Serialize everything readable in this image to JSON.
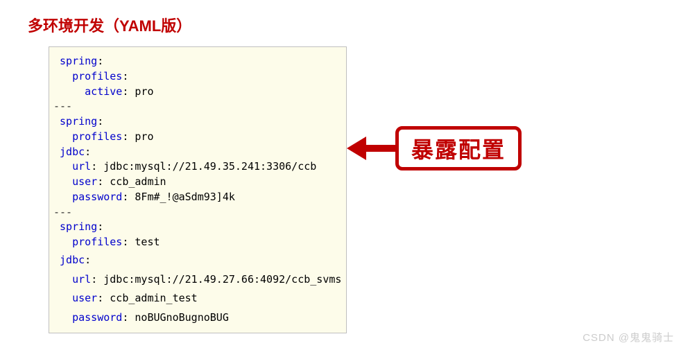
{
  "title": "多环境开发（YAML版）",
  "callout": "暴露配置",
  "watermark": "CSDN @鬼鬼骑士",
  "yaml": {
    "l1_key": "spring",
    "l2_key": "profiles",
    "l3_key": "active",
    "l3_val": "pro",
    "sep": "---",
    "l4_key": "spring",
    "l5_key": "profiles",
    "l5_val": "pro",
    "l6_key": "jdbc",
    "l7_key": "url",
    "l7_val": "jdbc:mysql://21.49.35.241:3306/ccb",
    "l8_key": "user",
    "l8_val": "ccb_admin",
    "l9_key": "password",
    "l9_val": "8Fm#_!@aSdm93]4k",
    "l10_key": "spring",
    "l11_key": "profiles",
    "l11_val": "test",
    "l12_key": "jdbc",
    "l13_key": "url",
    "l13_val": "jdbc:mysql://21.49.27.66:4092/ccb_svms",
    "l14_key": "user",
    "l14_val": "ccb_admin_test",
    "l15_key": "password",
    "l15_val": "noBUGnoBugnoBUG"
  }
}
